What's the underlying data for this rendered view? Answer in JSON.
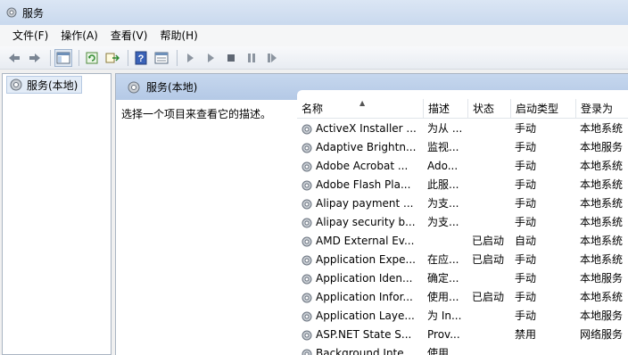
{
  "window": {
    "title": "服务"
  },
  "menu": [
    "文件(F)",
    "操作(A)",
    "查看(V)",
    "帮助(H)"
  ],
  "toolbar": {
    "icons": [
      "back-icon",
      "forward-icon",
      "show-console-tree-icon",
      "refresh-icon",
      "export-list-icon",
      "help-icon",
      "properties-icon",
      "start-service-icon",
      "start-alt-icon",
      "stop-service-icon",
      "pause-service-icon",
      "restart-service-icon"
    ]
  },
  "tree": {
    "root_label": "服务(本地)"
  },
  "content": {
    "header_label": "服务(本地)",
    "description_hint": "选择一个项目来查看它的描述。"
  },
  "columns": [
    "名称",
    "描述",
    "状态",
    "启动类型",
    "登录为"
  ],
  "services": [
    {
      "name": "ActiveX Installer ...",
      "desc": "为从 ...",
      "status": "",
      "startup": "手动",
      "logon": "本地系统"
    },
    {
      "name": "Adaptive Brightn...",
      "desc": "监视...",
      "status": "",
      "startup": "手动",
      "logon": "本地服务"
    },
    {
      "name": "Adobe Acrobat ...",
      "desc": "Ado...",
      "status": "",
      "startup": "手动",
      "logon": "本地系统"
    },
    {
      "name": "Adobe Flash Pla...",
      "desc": "此服...",
      "status": "",
      "startup": "手动",
      "logon": "本地系统"
    },
    {
      "name": "Alipay payment ...",
      "desc": "为支...",
      "status": "",
      "startup": "手动",
      "logon": "本地系统"
    },
    {
      "name": "Alipay security b...",
      "desc": "为支...",
      "status": "",
      "startup": "手动",
      "logon": "本地系统"
    },
    {
      "name": "AMD External Ev...",
      "desc": "",
      "status": "已启动",
      "startup": "自动",
      "logon": "本地系统"
    },
    {
      "name": "Application Expe...",
      "desc": "在应...",
      "status": "已启动",
      "startup": "手动",
      "logon": "本地系统"
    },
    {
      "name": "Application Iden...",
      "desc": "确定...",
      "status": "",
      "startup": "手动",
      "logon": "本地服务"
    },
    {
      "name": "Application Infor...",
      "desc": "使用...",
      "status": "已启动",
      "startup": "手动",
      "logon": "本地系统"
    },
    {
      "name": "Application Laye...",
      "desc": "为 In...",
      "status": "",
      "startup": "手动",
      "logon": "本地服务"
    },
    {
      "name": "ASP.NET State S...",
      "desc": "Prov...",
      "status": "",
      "startup": "禁用",
      "logon": "网络服务"
    },
    {
      "name": "Background Inte...",
      "desc": "使用...",
      "status": "",
      "startup": "",
      "logon": ""
    }
  ]
}
